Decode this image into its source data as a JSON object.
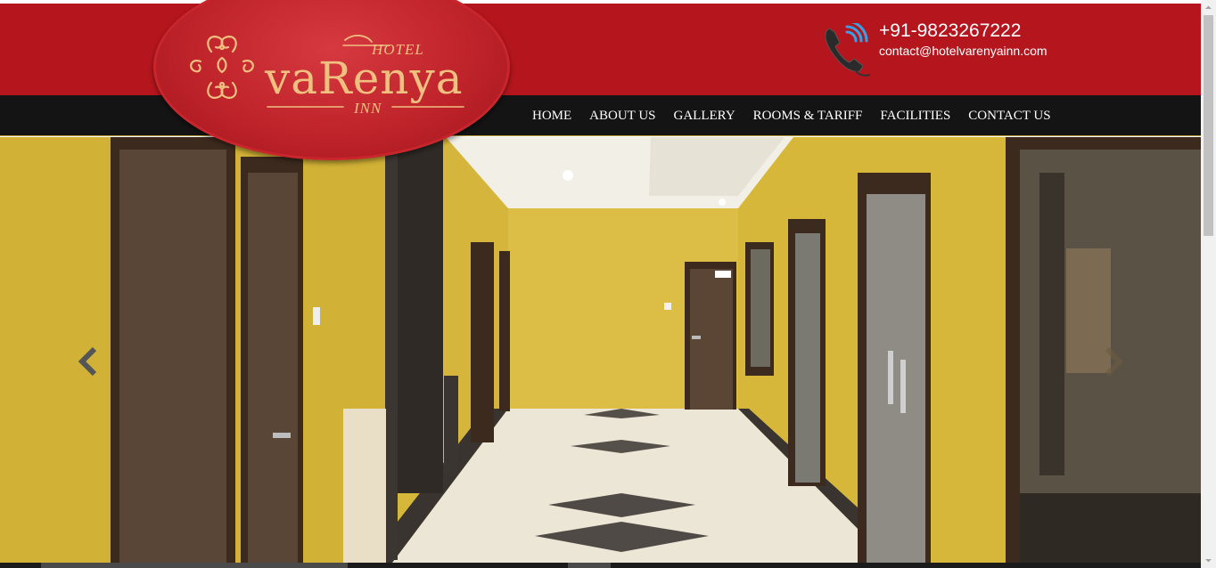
{
  "brand": {
    "hotel_label": "HOTEL",
    "name": "vaRenya",
    "inn_label": "INN"
  },
  "contact": {
    "phone": "+91-9823267222",
    "email": "contact@hotelvarenyainn.com",
    "icon": "phone-icon"
  },
  "nav": {
    "items": [
      {
        "label": "HOME"
      },
      {
        "label": "ABOUT US"
      },
      {
        "label": "GALLERY"
      },
      {
        "label": "ROOMS & TARIFF"
      },
      {
        "label": "FACILITIES"
      },
      {
        "label": "CONTACT US"
      }
    ]
  },
  "slider": {
    "prev_icon": "chevron-left-icon",
    "next_icon": "chevron-right-icon"
  },
  "colors": {
    "header_red": "#b5161d",
    "nav_bg": "#141414",
    "logo_gold": "#f0c080"
  }
}
